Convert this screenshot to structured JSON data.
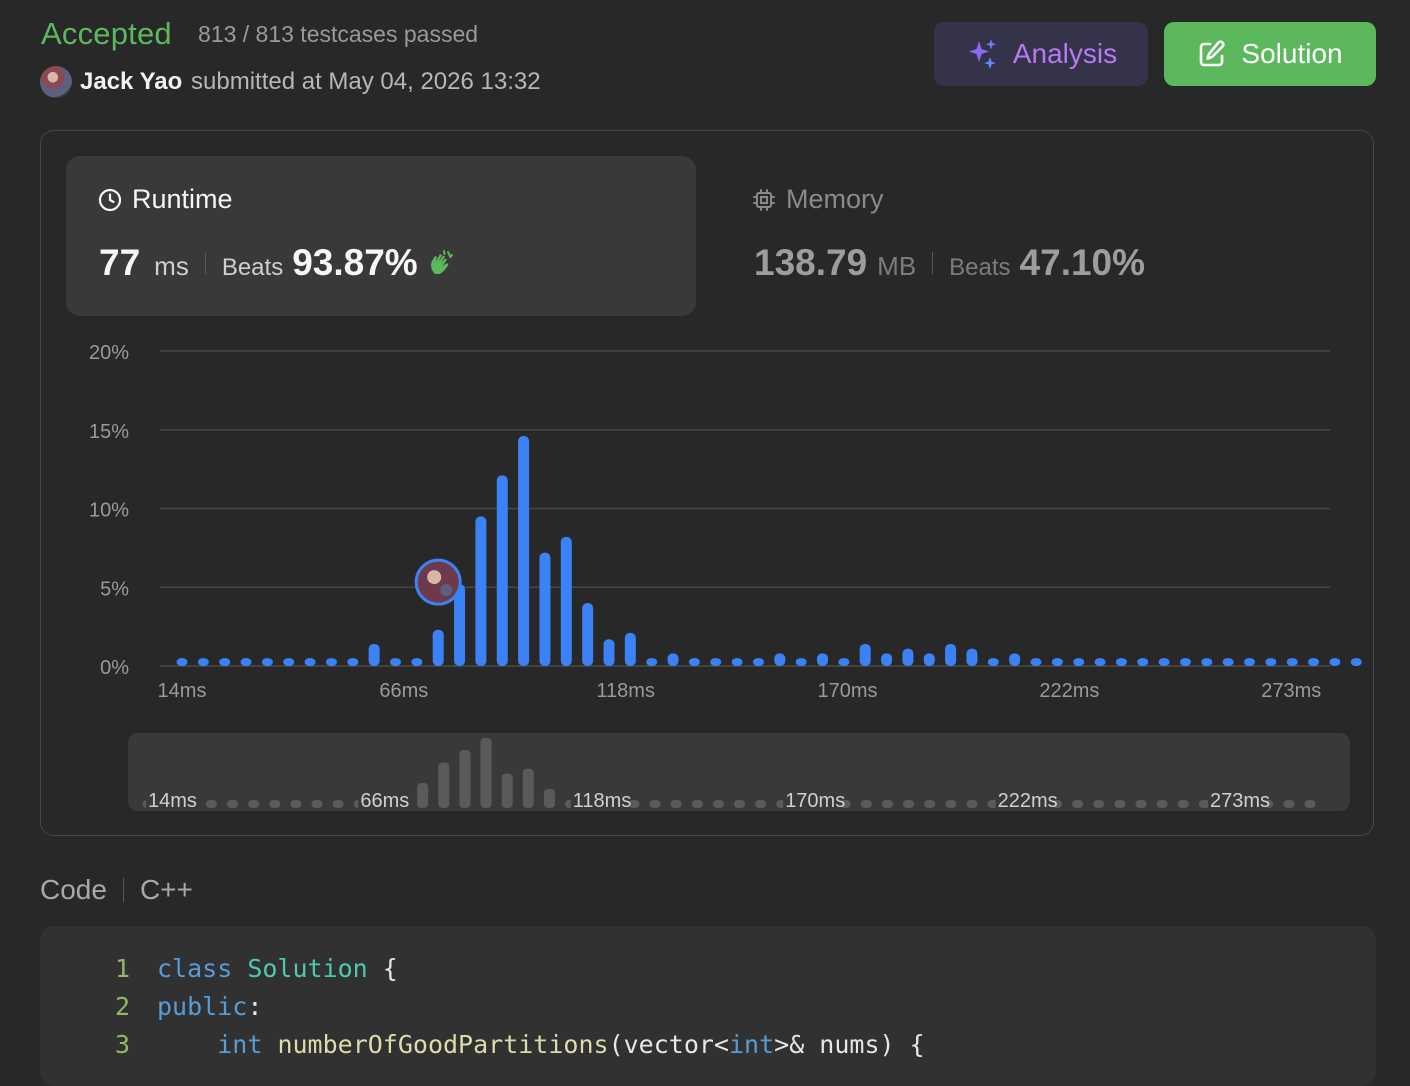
{
  "header": {
    "status": "Accepted",
    "testcases": "813 / 813 testcases passed",
    "user": "Jack Yao",
    "submitted": "submitted at May 04, 2026 13:32",
    "analysis_label": "Analysis",
    "solution_label": "Solution"
  },
  "runtime": {
    "title": "Runtime",
    "value": "77",
    "unit": "ms",
    "beats_label": "Beats",
    "beats": "93.87%"
  },
  "memory": {
    "title": "Memory",
    "value": "138.79",
    "unit": "MB",
    "beats_label": "Beats",
    "beats": "47.10%"
  },
  "chart_data": {
    "type": "bar",
    "y_ticks": [
      "20%",
      "15%",
      "10%",
      "5%",
      "0%"
    ],
    "ylim": [
      0,
      20
    ],
    "x_tick_labels": [
      "14ms",
      "66ms",
      "118ms",
      "170ms",
      "222ms",
      "273ms"
    ],
    "values": [
      0.5,
      0.5,
      0.5,
      0.5,
      0.5,
      0.5,
      0.5,
      0.5,
      0.5,
      1.4,
      0.5,
      0.5,
      2.3,
      5.2,
      9.5,
      12.1,
      14.6,
      7.2,
      8.2,
      4.0,
      1.7,
      2.1,
      0.5,
      0.8,
      0.5,
      0.5,
      0.5,
      0.5,
      0.8,
      0.5,
      0.8,
      0.5,
      1.4,
      0.8,
      1.1,
      0.8,
      1.4,
      1.1,
      0.5,
      0.8,
      0.5,
      0.5,
      0.5,
      0.5,
      0.5,
      0.5,
      0.5,
      0.5,
      0.5,
      0.5,
      0.5,
      0.5,
      0.5,
      0.5,
      0.5,
      0.5
    ],
    "highlight_index": 12,
    "bar_color": "#3b82f6",
    "overview_color": "#5a5a5a"
  },
  "code": {
    "label": "Code",
    "language": "C++",
    "lines": [
      {
        "n": "1",
        "parts": [
          [
            "kw",
            "class "
          ],
          [
            "ty",
            "Solution"
          ],
          [
            "pl",
            " {"
          ]
        ]
      },
      {
        "n": "2",
        "parts": [
          [
            "kw",
            "public"
          ],
          [
            "pl",
            ":"
          ]
        ]
      },
      {
        "n": "3",
        "parts": [
          [
            "pl",
            "    "
          ],
          [
            "kw",
            "int "
          ],
          [
            "fn",
            "numberOfGoodPartitions"
          ],
          [
            "pl",
            "(vector<"
          ],
          [
            "kw",
            "int"
          ],
          [
            "pl",
            ">& nums) {"
          ]
        ]
      }
    ]
  }
}
